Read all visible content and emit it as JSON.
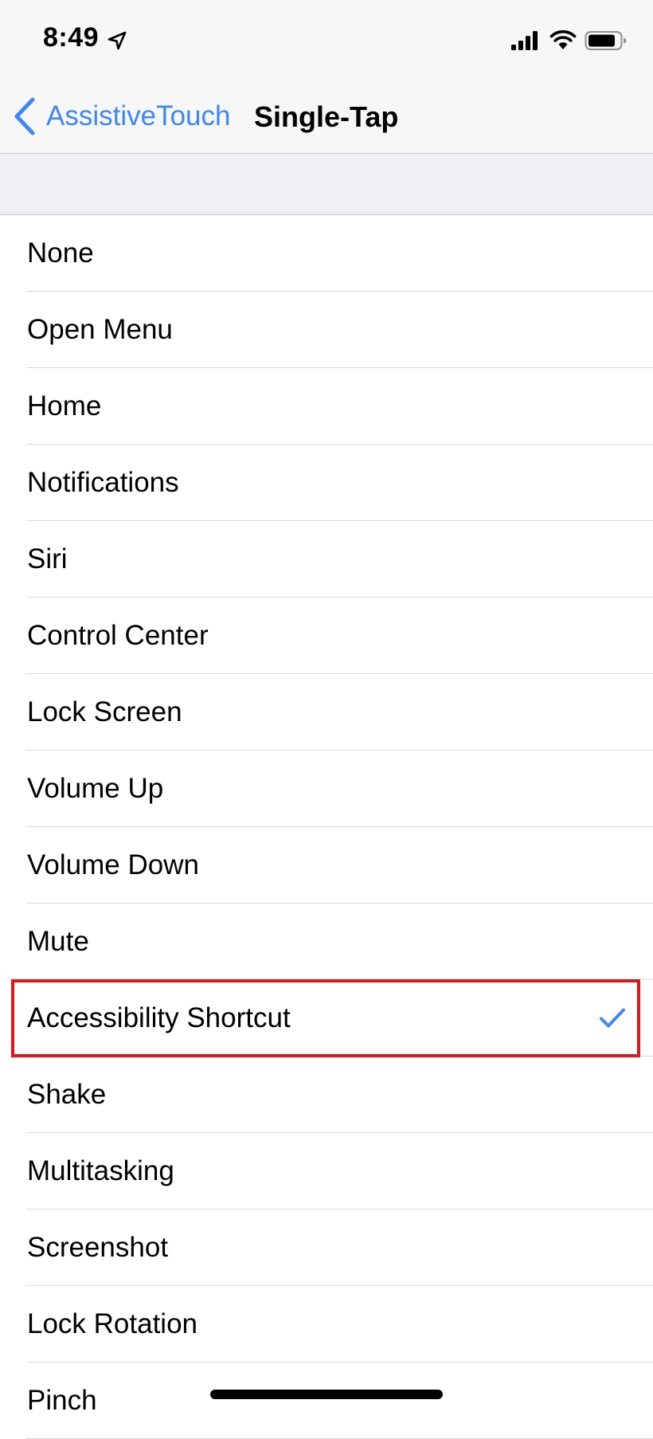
{
  "status_bar": {
    "time": "8:49",
    "icons": [
      "location-arrow-icon",
      "cellular-signal-icon",
      "wifi-icon",
      "battery-icon"
    ]
  },
  "nav": {
    "back_label": "AssistiveTouch",
    "title": "Single-Tap",
    "accent_color": "#3e87f7"
  },
  "options": [
    {
      "label": "None",
      "selected": false
    },
    {
      "label": "Open Menu",
      "selected": false
    },
    {
      "label": "Home",
      "selected": false
    },
    {
      "label": "Notifications",
      "selected": false
    },
    {
      "label": "Siri",
      "selected": false
    },
    {
      "label": "Control Center",
      "selected": false
    },
    {
      "label": "Lock Screen",
      "selected": false
    },
    {
      "label": "Volume Up",
      "selected": false
    },
    {
      "label": "Volume Down",
      "selected": false
    },
    {
      "label": "Mute",
      "selected": false
    },
    {
      "label": "Accessibility Shortcut",
      "selected": true
    },
    {
      "label": "Shake",
      "selected": false
    },
    {
      "label": "Multitasking",
      "selected": false
    },
    {
      "label": "Screenshot",
      "selected": false
    },
    {
      "label": "Lock Rotation",
      "selected": false
    },
    {
      "label": "Pinch",
      "selected": false
    }
  ],
  "colors": {
    "highlight_outline": "#e3151a",
    "checkmark": "#3e87f7",
    "group_background": "#efeff4"
  }
}
